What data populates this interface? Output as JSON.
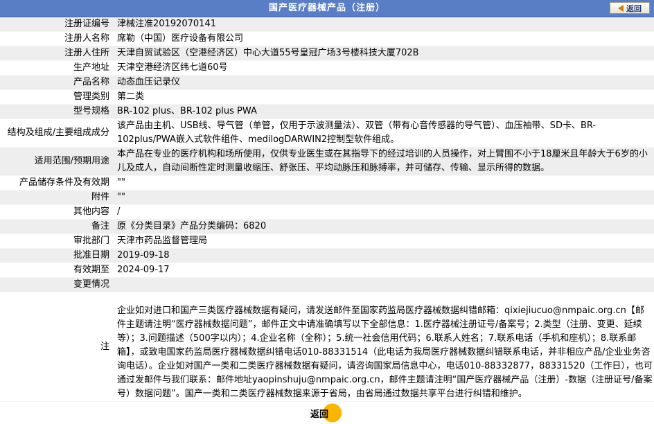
{
  "header": {
    "title": "国产医疗器械产品（注册）",
    "back_label": "返回"
  },
  "rows": [
    {
      "label": "注册证编号",
      "value": "津械注准20192070141"
    },
    {
      "label": "注册人名称",
      "value": "席勒（中国）医疗设备有限公司"
    },
    {
      "label": "注册人住所",
      "value": "天津自贸试验区（空港经济区）中心大道55号皇冠广场3号楼科技大厦702B"
    },
    {
      "label": "生产地址",
      "value": "天津空港经济区纬七道60号"
    },
    {
      "label": "产品名称",
      "value": "动态血压记录仪"
    },
    {
      "label": "管理类别",
      "value": "第二类"
    },
    {
      "label": "型号规格",
      "value": "BR-102 plus、BR-102 plus PWA"
    },
    {
      "label": "结构及组成/主要组成成分",
      "value": "该产品由主机、USB线、导气管（单管，仅用于示波测量法）、双管（带有心音传感器的导气管）、血压袖带、SD卡、BR-102plus/PWA嵌入式软件组件、medilogDARWIN2控制型软件组成。"
    },
    {
      "label": "适用范围/预期用途",
      "value": "本产品在专业的医疗机构和场所使用，仅供专业医生或在其指导下的经过培训的人员操作，对上臂围不小于18厘米且年龄大于6岁的小儿及成人，自动间断性定时测量收缩压、舒张压、平均动脉压和脉搏率，并可储存、传输、显示所得的数据。"
    },
    {
      "label": "产品储存条件及有效期",
      "value": "\"\""
    },
    {
      "label": "附件",
      "value": "\"\""
    },
    {
      "label": "其他内容",
      "value": "/"
    },
    {
      "label": "备注",
      "value": "原《分类目录》产品分类编码：6820"
    },
    {
      "label": "审批部门",
      "value": "天津市药品监督管理局"
    },
    {
      "label": "批准日期",
      "value": "2019-09-18"
    },
    {
      "label": "有效期至",
      "value": "2024-09-17"
    },
    {
      "label": "变更情况",
      "value": ""
    },
    {
      "label": "注",
      "value": "企业如对进口和国产三类医疗器械数据有疑问，请发送邮件至国家药监局医疗器械数据纠错邮箱：qixiejiucuo@nmpaic.org.cn【邮件主题请注明“医疗器械数据问题”，邮件正文中请准确填写以下全部信息：1.医疗器械注册证号/备案号；2.类型（注册、变更、延续等）；3.问题描述（500字以内）；4.企业名称（全称）；5.统一社会信用代码；6.联系人姓名；7.联系电话（手机和座机）；8.联系邮箱】，或致电国家药监局医疗器械数据纠错电话010-88331514（此电话为我局医疗器械数据纠错联系电话，并非相应产品/企业业务咨询电话）。企业如对国产一类和二类医疗器械数据有疑问，请咨询国家局信息中心，电话010-88332877，88331520（工作日），也可通过发邮件与我们联系：邮件地址yaopinshuju@nmpaic.org.cn，邮件主题请注明“国产医疗器械产品（注册）-数据（注册证号/备案号）数据问题”。国产一类和二类医疗器械数据来源于省局，由省局通过数据共享平台进行纠错和维护。"
    }
  ],
  "footer": {
    "back_label": "返回"
  }
}
